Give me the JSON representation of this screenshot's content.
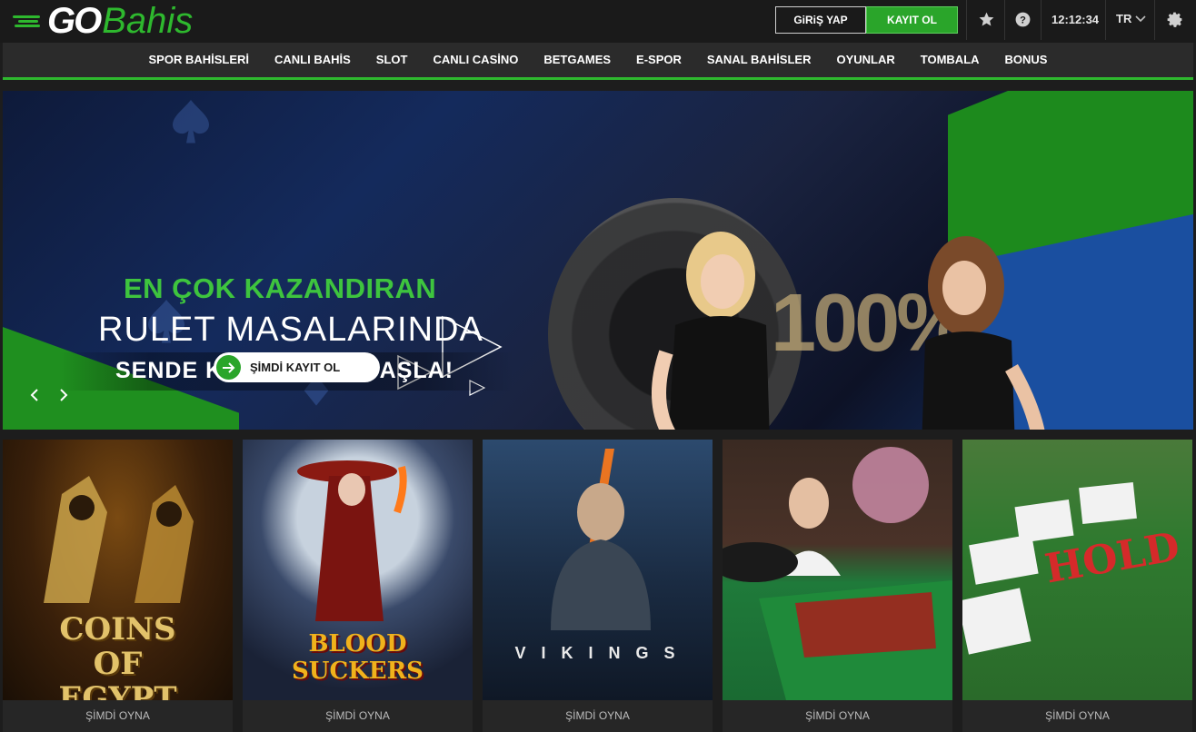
{
  "brand": {
    "go": "GO",
    "bahis": "Bahis"
  },
  "auth": {
    "login_label": "GiRiŞ YAP",
    "register_label": "KAYIT OL"
  },
  "toolbar": {
    "time": "12:12:34",
    "lang": "TR"
  },
  "nav": {
    "items": [
      {
        "label": "SPOR BAHİSLERİ"
      },
      {
        "label": "CANLI BAHİS"
      },
      {
        "label": "SLOT"
      },
      {
        "label": "CANLI CASİNO"
      },
      {
        "label": "BETGAMES"
      },
      {
        "label": "E-SPOR"
      },
      {
        "label": "SANAL BAHİSLER"
      },
      {
        "label": "OYUNLAR"
      },
      {
        "label": "TOMBALA"
      },
      {
        "label": "BONUS"
      }
    ]
  },
  "banner": {
    "line1": "EN ÇOK KAZANDIRAN",
    "line2": "RULET MASALARINDA",
    "line3": "SENDE KAZANMAYA BAŞLA!",
    "cta_label": "ŞİMDİ KAYIT OL",
    "bg_text": "100%"
  },
  "games": [
    {
      "title": "COINS OF EGYPT",
      "play_label": "ŞİMDİ OYNA"
    },
    {
      "title": "BLOOD SUCKERS",
      "play_label": "ŞİMDİ OYNA"
    },
    {
      "title": "V I K I N G S",
      "play_label": "ŞİMDİ OYNA"
    },
    {
      "title": "",
      "play_label": "ŞİMDİ OYNA"
    },
    {
      "title": "HOLD",
      "play_label": "ŞİMDİ OYNA"
    }
  ],
  "colors": {
    "accent": "#2eb82e",
    "topbar": "#1a1a1a",
    "nav": "#2b2b2b"
  },
  "icons": [
    "star-icon",
    "help-icon",
    "chevron-down-icon",
    "gear-icon",
    "arrow-right-icon",
    "chevron-left-icon",
    "chevron-right-icon"
  ]
}
